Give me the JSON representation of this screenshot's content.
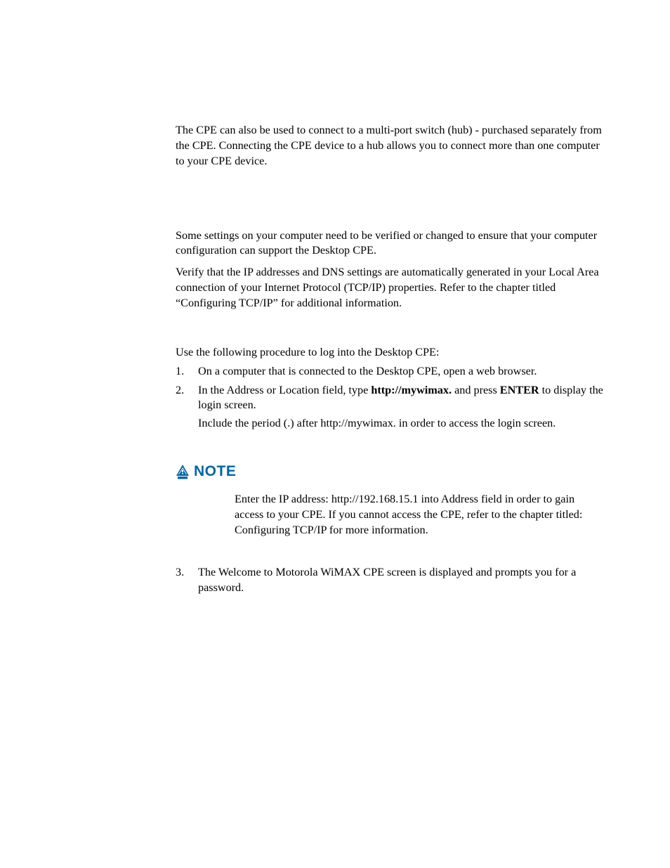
{
  "intro_para": "The CPE can also be used to connect to a multi-port switch (hub) - purchased separately from the CPE. Connecting the CPE device to a hub allows you to connect more than one computer to your CPE device.",
  "config_para_1": "Some settings on your computer need to be verified or changed to ensure that your computer configuration can support the Desktop CPE.",
  "config_para_2": "Verify that the IP addresses and DNS settings are automatically generated in your Local Area connection of your Internet Protocol (TCP/IP) properties. Refer to the chapter titled “Configuring TCP/IP” for additional information.",
  "procedure_intro": "Use the following procedure to log into the Desktop CPE:",
  "steps": {
    "s1_num": "1.",
    "s1_text": "On a computer that is connected to the Desktop CPE, open a web browser.",
    "s2_num": "2.",
    "s2_pre": "In the Address or Location field, type ",
    "s2_url": "http://mywimax.",
    "s2_mid": " and press ",
    "s2_enter": "ENTER",
    "s2_post": " to display the login screen.",
    "s2_continue": "Include the period (.) after http://mywimax. in order to access the login screen.",
    "s3_num": "3.",
    "s3_text": "The Welcome to Motorola WiMAX CPE screen is displayed and prompts you for a password."
  },
  "note": {
    "label": "NOTE",
    "body": "Enter the IP address: http://192.168.15.1 into Address field in order to gain access to your CPE. If you cannot access the CPE, refer to the chapter titled: Configuring TCP/IP for more information.",
    "icon_name": "note-alert-icon"
  },
  "colors": {
    "note_blue": "#0066a4"
  }
}
